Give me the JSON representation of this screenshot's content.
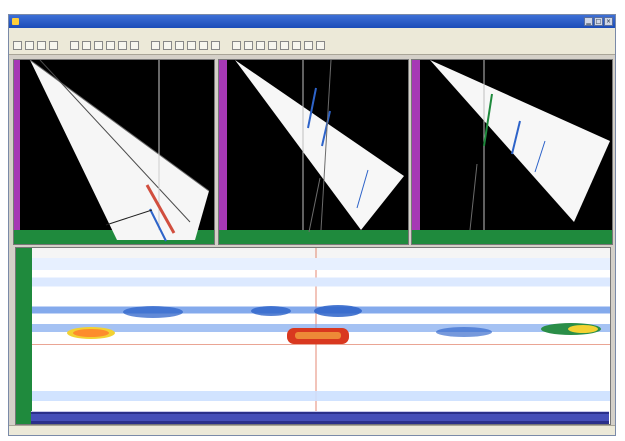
{
  "window": {
    "title": ""
  },
  "menu": {
    "items": []
  },
  "statusbar": {
    "cells": []
  },
  "colors": {
    "panel_bg": "#000000",
    "left_ruler": "#a638b5",
    "bottom_ruler": "#1f8a3d",
    "wide_ruler": "#1f8a3d",
    "cursor_line": "#d64b2a",
    "signal_blue": "#2d63c9",
    "signal_red": "#c9371f",
    "signal_yellow": "#f3d232"
  },
  "icons": [
    "app-icon",
    "minimize-icon",
    "maximize-icon",
    "close-icon",
    "toolbar-icons"
  ]
}
